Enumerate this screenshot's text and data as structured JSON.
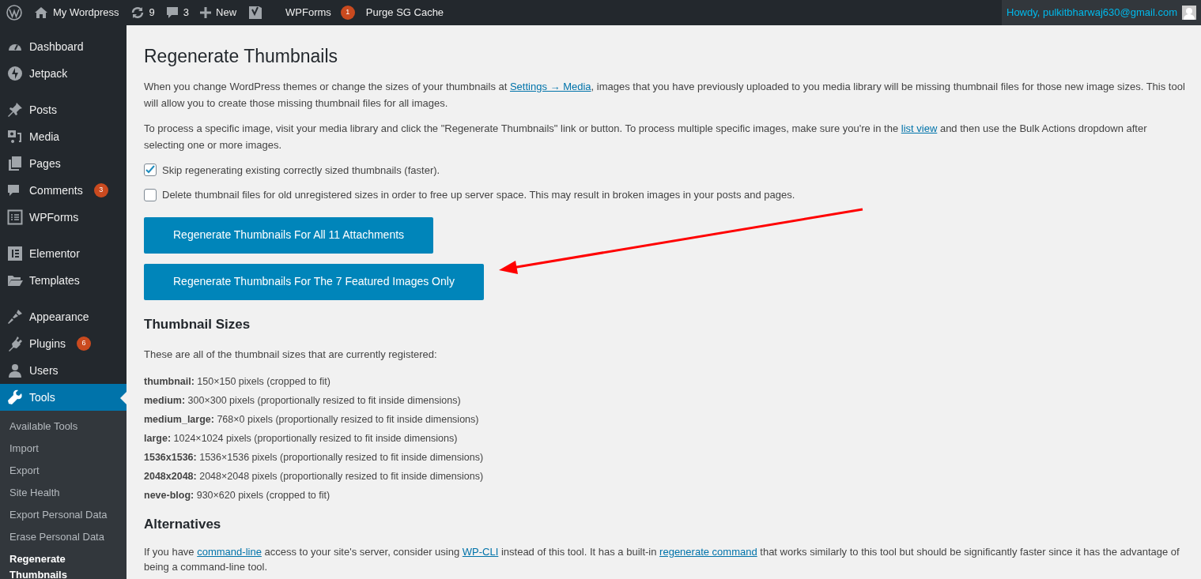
{
  "admin_bar": {
    "site": "My Wordpress",
    "updates": "9",
    "comments": "3",
    "new": "New",
    "wpforms": {
      "label": "WPForms",
      "badge": "1"
    },
    "purge": "Purge SG Cache",
    "howdy": "Howdy, pulkitbharwaj630@gmail.com"
  },
  "sidebar": {
    "groups": [
      [
        {
          "label": "Dashboard",
          "selected": false
        },
        {
          "label": "Jetpack",
          "selected": false
        }
      ],
      [
        {
          "label": "Posts",
          "selected": false
        },
        {
          "label": "Media",
          "selected": false
        },
        {
          "label": "Pages",
          "selected": false
        },
        {
          "label": "Comments",
          "badge": "3",
          "selected": false
        },
        {
          "label": "WPForms",
          "selected": false
        }
      ],
      [
        {
          "label": "Elementor",
          "selected": false
        },
        {
          "label": "Templates",
          "selected": false
        }
      ],
      [
        {
          "label": "Appearance",
          "selected": false
        },
        {
          "label": "Plugins",
          "badge": "6",
          "selected": false
        },
        {
          "label": "Users",
          "selected": false
        },
        {
          "label": "Tools",
          "selected": true
        }
      ]
    ],
    "submenu": [
      {
        "label": "Available Tools",
        "selected": false
      },
      {
        "label": "Import",
        "selected": false
      },
      {
        "label": "Export",
        "selected": false
      },
      {
        "label": "Site Health",
        "selected": false
      },
      {
        "label": "Export Personal Data",
        "selected": false
      },
      {
        "label": "Erase Personal Data",
        "selected": false
      },
      {
        "label": "Regenerate Thumbnails",
        "selected": true
      }
    ]
  },
  "page": {
    "title": "Regenerate Thumbnails",
    "intro": [
      [
        {
          "text": "When you change WordPress themes or change the sizes of your thumbnails at "
        },
        {
          "link": "Settings → Media"
        },
        {
          "text": ", images that you have previously uploaded to you media library will be missing thumbnail files for those new image sizes. This tool will allow you to create those missing thumbnail files for all images."
        }
      ],
      [
        {
          "text": "To process a specific image, visit your media library and click the \"Regenerate Thumbnails\" link or button. To process multiple specific images, make sure you're in the "
        },
        {
          "link": "list view"
        },
        {
          "text": " and then use the Bulk Actions dropdown after selecting one or more images."
        }
      ]
    ],
    "options": [
      {
        "label": "Skip regenerating existing correctly sized thumbnails (faster).",
        "checked": true
      },
      {
        "label": "Delete thumbnail files for old unregistered sizes in order to free up server space. This may result in broken images in your posts and pages.",
        "checked": false
      }
    ],
    "buttons": [
      "Regenerate Thumbnails For All 11 Attachments",
      "Regenerate Thumbnails For The 7 Featured Images Only"
    ],
    "sizes_heading": "Thumbnail Sizes",
    "sizes_intro": "These are all of the thumbnail sizes that are currently registered:",
    "sizes": [
      "**thumbnail:** 150×150 pixels (cropped to fit)",
      "**medium:** 300×300 pixels (proportionally resized to fit inside dimensions)",
      "**medium_large:** 768×0 pixels (proportionally resized to fit inside dimensions)",
      "**large:** 1024×1024 pixels (proportionally resized to fit inside dimensions)",
      "**1536x1536:** 1536×1536 pixels (proportionally resized to fit inside dimensions)",
      "**2048x2048:** 2048×2048 pixels (proportionally resized to fit inside dimensions)",
      "**neve-blog:** 930×620 pixels (cropped to fit)"
    ],
    "alt_heading": "Alternatives",
    "alt_text": [
      {
        "text": "If you have "
      },
      {
        "link": "command-line"
      },
      {
        "text": " access to your site's server, consider using "
      },
      {
        "link": "WP-CLI"
      },
      {
        "text": " instead of this tool. It has a built-in "
      },
      {
        "link": "regenerate command"
      },
      {
        "text": " that works similarly to this tool but should be significantly faster since it has the advantage of being a command-line tool."
      }
    ]
  }
}
